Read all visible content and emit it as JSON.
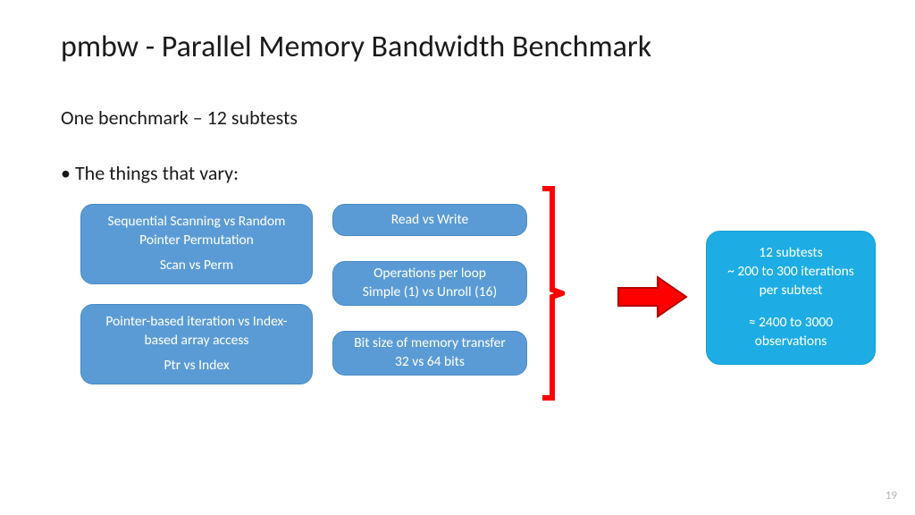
{
  "title": "pmbw - Parallel Memory Bandwidth Benchmark",
  "subtitle": "One benchmark – 12 subtests",
  "bullet": "The things that vary:",
  "boxes": {
    "b1_line1": "Sequential Scanning vs Random",
    "b1_line2": "Pointer Permutation",
    "b1_sub": "Scan vs Perm",
    "b2_line1": "Pointer-based iteration vs Index-",
    "b2_line2": "based array access",
    "b2_sub": "Ptr vs Index",
    "b3": "Read vs Write",
    "b4_line1": "Operations per loop",
    "b4_line2": "Simple (1) vs Unroll (16)",
    "b5_line1": "Bit size of memory transfer",
    "b5_line2": "32 vs 64 bits"
  },
  "summary": {
    "line1": "12 subtests",
    "line2": "~ 200 to 300 iterations",
    "line3": "per subtest",
    "line4": "≈ 2400 to 3000",
    "line5": "observations"
  },
  "page_number": "19"
}
